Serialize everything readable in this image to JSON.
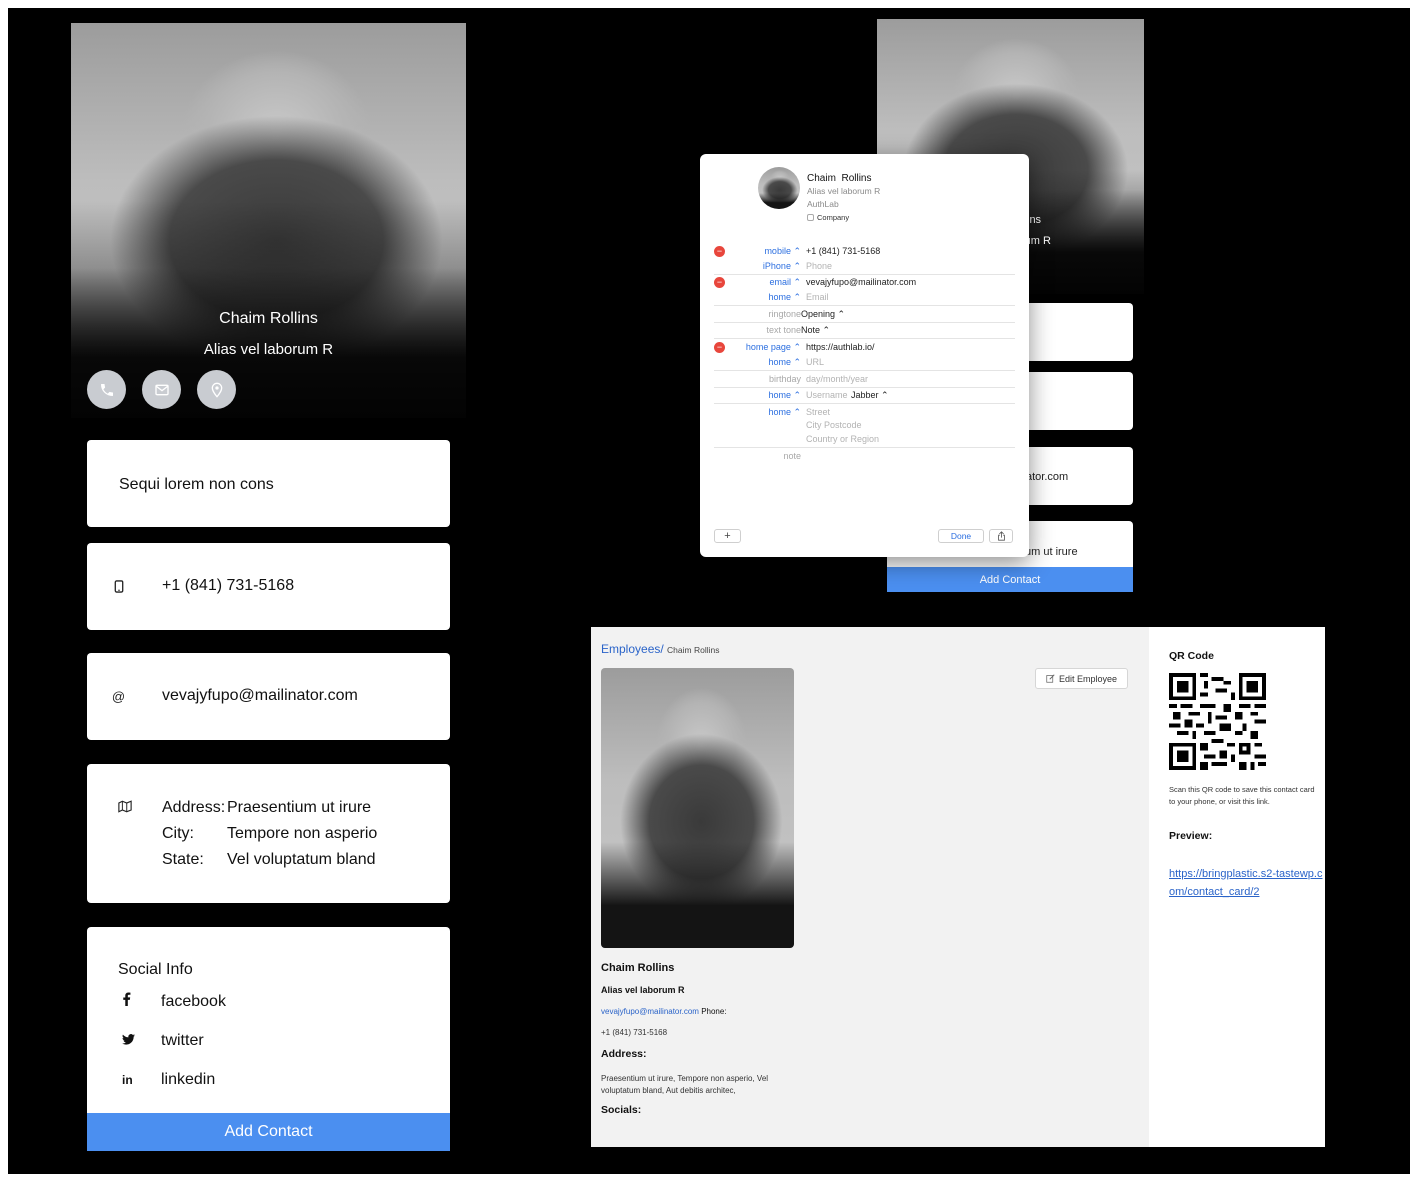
{
  "mobile": {
    "name": "Chaim Rollins",
    "title": "Alias vel laborum R",
    "bio": "Sequi lorem non cons",
    "phone": "+1 (841) 731-5168",
    "email": "vevajyfupo@mailinator.com",
    "address": {
      "address_label": "Address:",
      "address_value": "Praesentium ut irure",
      "city_label": "City:",
      "city_value": "Tempore non asperio",
      "state_label": "State:",
      "state_value": "Vel voluptatum bland"
    },
    "social": {
      "heading": "Social Info",
      "items": [
        {
          "label": "facebook",
          "icon": "facebook-icon"
        },
        {
          "label": "twitter",
          "icon": "twitter-icon"
        },
        {
          "label": "linkedin",
          "icon": "linkedin-icon"
        }
      ]
    },
    "add_contact_label": "Add Contact",
    "accent_color": "#4b8ff0"
  },
  "back_phone": {
    "hero_name_fragment": "ins",
    "hero_title_fragment": "rum R",
    "email_fragment": "ator.com",
    "address_fragment": "um ut irure",
    "add_contact_label": "Add Contact"
  },
  "contact_popup": {
    "first_name": "Chaim",
    "last_name": "Rollins",
    "job_title": "Alias vel laborum R",
    "company_name": "AuthLab",
    "company_checkbox_label": "Company",
    "rows": {
      "mobile_label": "mobile",
      "mobile_value": "+1 (841) 731-5168",
      "iphone_label": "iPhone",
      "iphone_placeholder": "Phone",
      "email_label": "email",
      "email_value": "vevajyfupo@mailinator.com",
      "email_home_label": "home",
      "email_home_placeholder": "Email",
      "ringtone_label": "ringtone",
      "ringtone_value": "Opening",
      "texttone_label": "text tone",
      "texttone_value": "Note",
      "homepage_label": "home page",
      "homepage_value": "https://authlab.io/",
      "url_home_label": "home",
      "url_placeholder": "URL",
      "birthday_label": "birthday",
      "birthday_placeholder": "day/month/year",
      "im_label": "home",
      "im_placeholder": "Username",
      "im_service": "Jabber",
      "addr_label": "home",
      "street_placeholder": "Street",
      "city_postcode_placeholder": "City Postcode",
      "country_placeholder": "Country or Region",
      "note_label": "note"
    },
    "plus_label": "+",
    "done_label": "Done"
  },
  "employee_page": {
    "breadcrumb_root": "Employees/",
    "breadcrumb_current": "Chaim Rollins",
    "edit_button_label": "Edit Employee",
    "name": "Chaim Rollins",
    "title": "Alias vel laborum R",
    "email": "vevajyfupo@mailinator.com",
    "phone_label": "Phone:",
    "phone": "+1 (841) 731-5168",
    "address_heading": "Address:",
    "address_text": "Praesentium ut irure, Tempore non asperio, Vel voluptatum bland, Aut debitis architec,",
    "socials_heading": "Socials:",
    "qr_heading": "QR Code",
    "qr_note": "Scan this QR code to save this contact card to your phone, or visit this link.",
    "preview_heading": "Preview:",
    "preview_link": "https://bringplastic.s2-tastewp.com/contact_card/2"
  }
}
